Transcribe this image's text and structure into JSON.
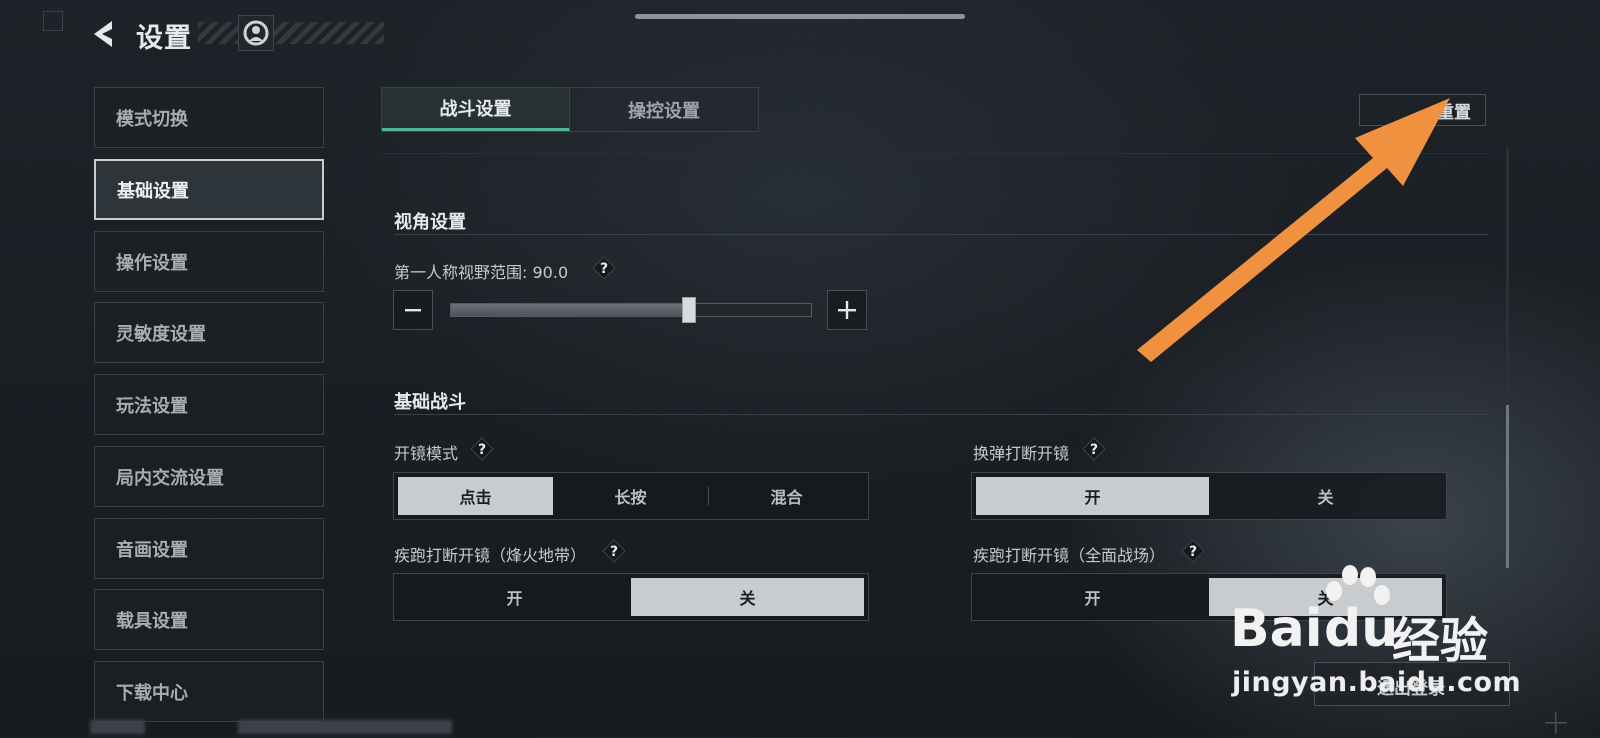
{
  "header": {
    "title": "设置"
  },
  "sidebar": {
    "items": [
      {
        "label": "模式切换",
        "active": false
      },
      {
        "label": "基础设置",
        "active": true
      },
      {
        "label": "操作设置",
        "active": false
      },
      {
        "label": "灵敏度设置",
        "active": false
      },
      {
        "label": "玩法设置",
        "active": false
      },
      {
        "label": "局内交流设置",
        "active": false
      },
      {
        "label": "音画设置",
        "active": false
      },
      {
        "label": "载具设置",
        "active": false
      },
      {
        "label": "下载中心",
        "active": false
      }
    ]
  },
  "tabs": [
    {
      "label": "战斗设置",
      "active": true
    },
    {
      "label": "操控设置",
      "active": false
    }
  ],
  "reset_button": "重置",
  "view_section": {
    "title": "视角设置",
    "fov_label": "第一人称视野范围:",
    "fov_value": "90.0",
    "fov_fraction": 0.66
  },
  "combat_section": {
    "title": "基础战斗",
    "scope_mode": {
      "label": "开镜模式",
      "options": [
        "点击",
        "长按",
        "混合"
      ],
      "selected": 0
    },
    "reload_interrupt": {
      "label": "换弹打断开镜",
      "options": [
        "开",
        "关"
      ],
      "selected": 0
    },
    "sprint_interrupt_warzone": {
      "label": "疾跑打断开镜（烽火地带）",
      "options": [
        "开",
        "关"
      ],
      "selected": 1
    },
    "sprint_interrupt_fullscale": {
      "label": "疾跑打断开镜（全面战场）",
      "options": [
        "开",
        "关"
      ],
      "selected": 1
    }
  },
  "footer_button": "退出登录",
  "watermark": {
    "brand_left": "Bai",
    "brand_right": "du",
    "brand_cn": "经验",
    "url": "jingyan.baidu.com"
  },
  "colors": {
    "accent": "#4fb592",
    "annotation_arrow": "#f0913f",
    "selected_option": "#c9cccf"
  },
  "icons": {
    "back": "back-arrow-icon",
    "avatar": "avatar-icon",
    "help": "help-icon",
    "minus": "minus-icon",
    "plus": "plus-icon"
  }
}
